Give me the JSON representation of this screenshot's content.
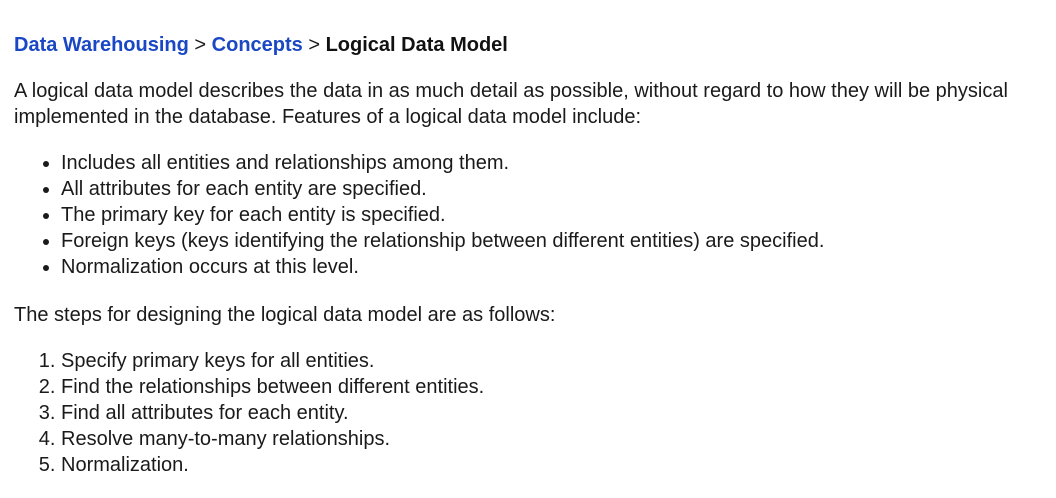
{
  "breadcrumb": {
    "items": [
      {
        "label": "Data Warehousing"
      },
      {
        "label": "Concepts"
      }
    ],
    "separator": ">",
    "current": "Logical Data Model",
    "link_color": "#1a47c4"
  },
  "intro": "A logical data model describes the data in as much detail as possible, without regard to how they will be physical implemented in the database. Features of a logical data model include:",
  "features": [
    "Includes all entities and relationships among them.",
    "All attributes for each entity are specified.",
    "The primary key for each entity is specified.",
    "Foreign keys (keys identifying the relationship between different entities) are specified.",
    "Normalization occurs at this level."
  ],
  "steps_intro": "The steps for designing the logical data model are as follows:",
  "steps": [
    "Specify primary keys for all entities.",
    "Find the relationships between different entities.",
    "Find all attributes for each entity.",
    "Resolve many-to-many relationships.",
    "Normalization."
  ]
}
